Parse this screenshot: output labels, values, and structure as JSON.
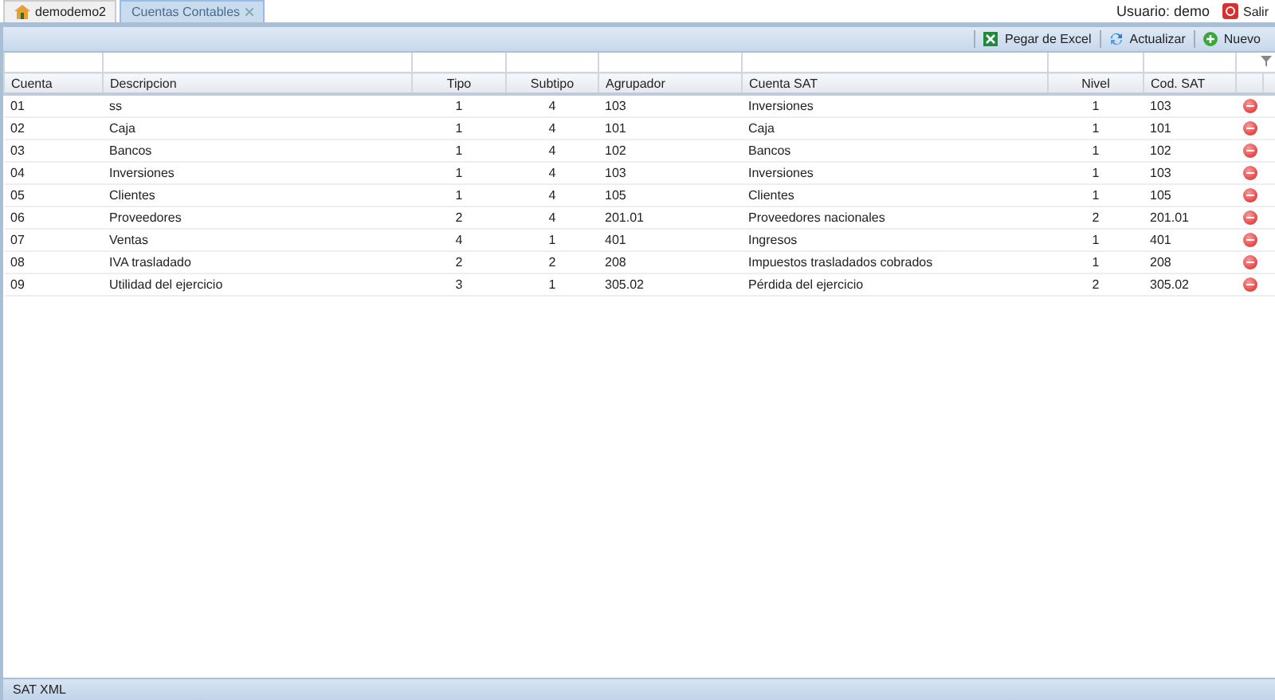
{
  "tabs": [
    {
      "label": "demodemo2",
      "kind": "home",
      "selected": false
    },
    {
      "label": "Cuentas Contables",
      "kind": "closable",
      "selected": true
    }
  ],
  "user": {
    "label": "Usuario: demo",
    "logout": "Salir"
  },
  "toolbar": [
    {
      "label": "Pegar de Excel",
      "kind": "excel"
    },
    {
      "label": "Actualizar",
      "kind": "refresh"
    },
    {
      "label": "Nuevo",
      "kind": "add"
    }
  ],
  "table": {
    "columns": [
      "Cuenta",
      "Descripcion",
      "Tipo",
      "Subtipo",
      "Agrupador",
      "Cuenta SAT",
      "Nivel",
      "Cod. SAT"
    ],
    "rows": [
      [
        "01",
        "ss",
        "1",
        "4",
        "103",
        "Inversiones",
        "1",
        "103"
      ],
      [
        "02",
        "Caja",
        "1",
        "4",
        "101",
        "Caja",
        "1",
        "101"
      ],
      [
        "03",
        "Bancos",
        "1",
        "4",
        "102",
        "Bancos",
        "1",
        "102"
      ],
      [
        "04",
        "Inversiones",
        "1",
        "4",
        "103",
        "Inversiones",
        "1",
        "103"
      ],
      [
        "05",
        "Clientes",
        "1",
        "4",
        "105",
        "Clientes",
        "1",
        "105"
      ],
      [
        "06",
        "Proveedores",
        "2",
        "4",
        "201.01",
        "Proveedores nacionales",
        "2",
        "201.01"
      ],
      [
        "07",
        "Ventas",
        "4",
        "1",
        "401",
        "Ingresos",
        "1",
        "401"
      ],
      [
        "08",
        "IVA trasladado",
        "2",
        "2",
        "208",
        "Impuestos trasladados cobrados",
        "1",
        "208"
      ],
      [
        "09",
        "Utilidad del ejercicio",
        "3",
        "1",
        "305.02",
        "Pérdida del ejercicio",
        "2",
        "305.02"
      ]
    ]
  },
  "status_bar": "SAT XML"
}
